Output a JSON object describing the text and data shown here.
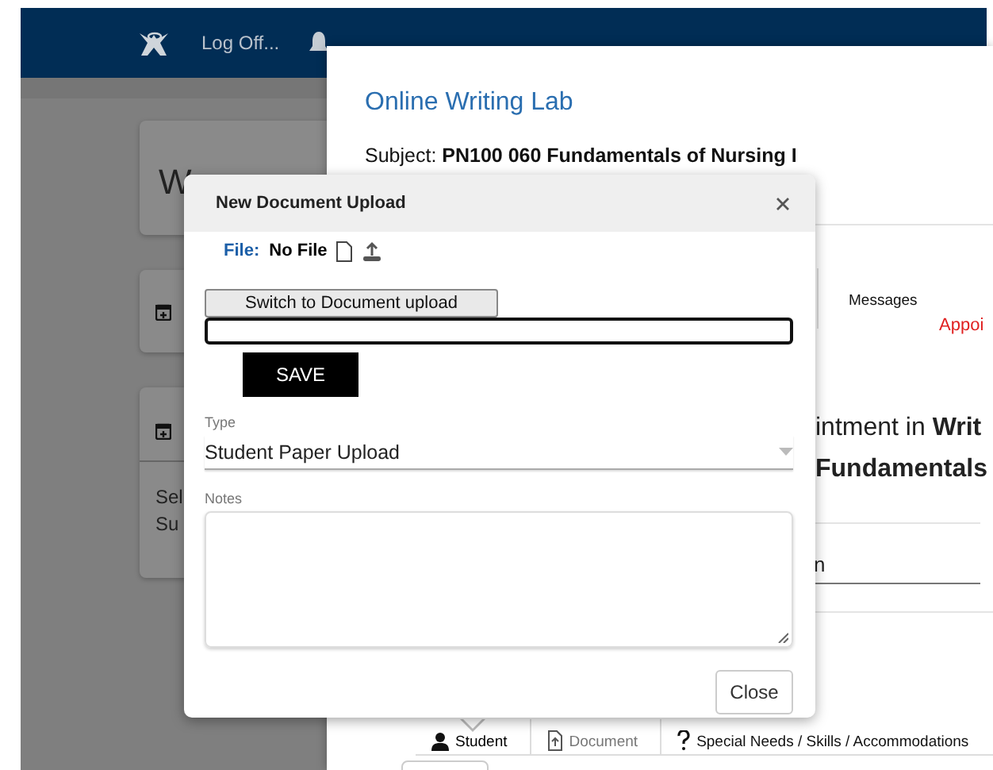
{
  "header": {
    "logoff": "Log Off..."
  },
  "cards": [
    {
      "kind": "title",
      "text": "W"
    },
    {
      "kind": "icon"
    },
    {
      "kind": "list",
      "lines": [
        "Sel",
        "Su"
      ]
    }
  ],
  "appointment_window": {
    "title": "Online Writing Lab",
    "subject_label": "Subject:",
    "subject": "PN100 060 Fundamentals of Nursing I",
    "messages_tab": "Messages",
    "alert": "Appoi",
    "heading": "intment in **Writ**",
    "heading_2": "Fundamentals",
    "field_value": "n",
    "tabs": [
      {
        "kind": "student",
        "label": "Student",
        "selected": true
      },
      {
        "kind": "document",
        "label": "Document",
        "selected": false
      },
      {
        "kind": "help",
        "label": "Special Needs / Skills / Accommodations",
        "selected": false
      }
    ]
  },
  "dialog": {
    "title": "New Document Upload",
    "file_label": "File:",
    "file_name": "No File",
    "switch_button": "Switch to Document upload",
    "save_button": "SAVE",
    "type_label": "Type",
    "type_value": "Student Paper Upload",
    "notes_label": "Notes",
    "close_button": "Close"
  }
}
